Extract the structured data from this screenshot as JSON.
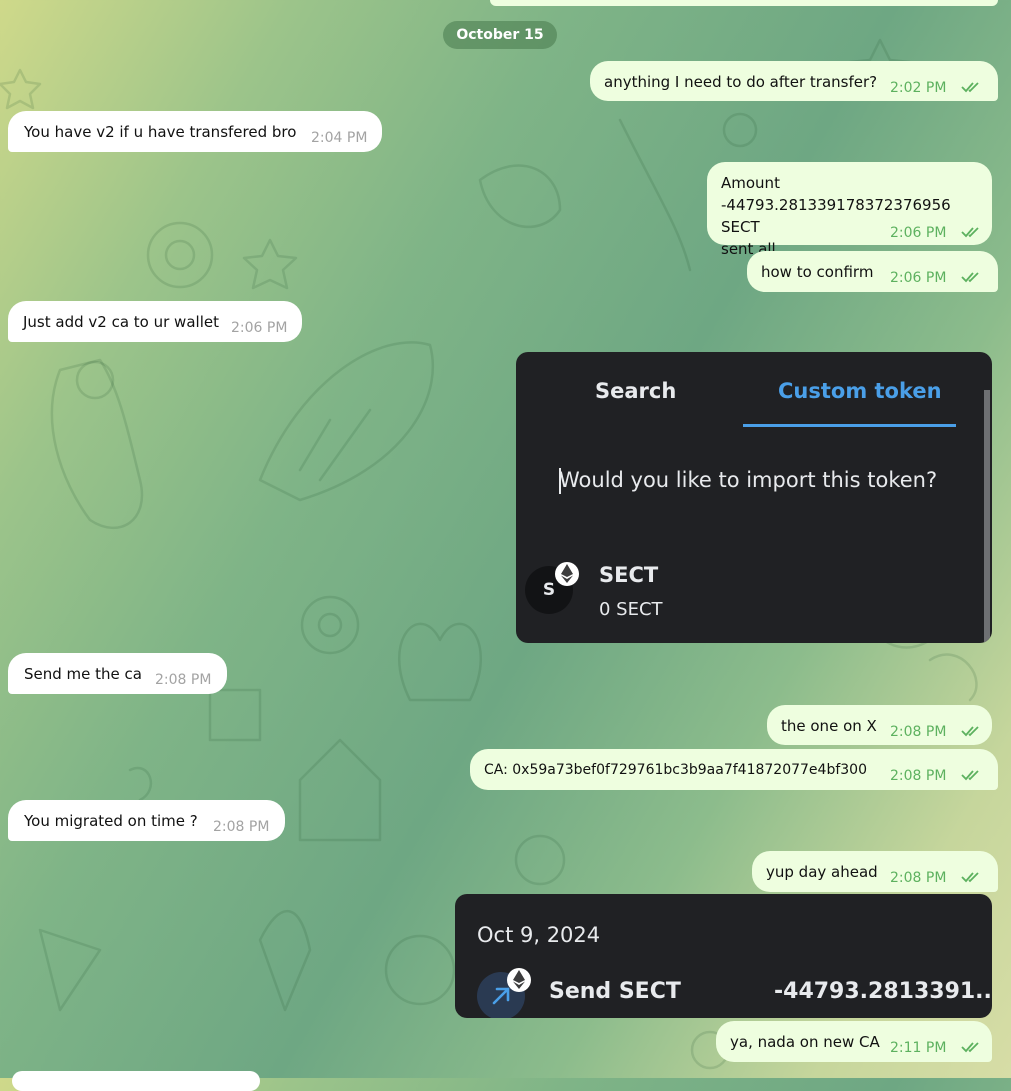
{
  "chat": {
    "date_separator": "October 15",
    "messages": [
      {
        "id": "m1",
        "text": "anything I need to do after transfer?",
        "time": "2:02 PM"
      },
      {
        "id": "m2",
        "text": "You have v2 if u have transfered bro",
        "time": "2:04 PM"
      },
      {
        "id": "m3",
        "lines": [
          "Amount",
          "-44793.281339178372376956 SECT",
          "sent all"
        ],
        "time": "2:06 PM"
      },
      {
        "id": "m4",
        "text": "how to confirm",
        "time": "2:06 PM"
      },
      {
        "id": "m5",
        "text": "Just add v2 ca to ur wallet",
        "time": "2:06 PM"
      },
      {
        "id": "m6",
        "text": "Send me the ca",
        "time": "2:08 PM"
      },
      {
        "id": "m7",
        "text": "the one on X",
        "time": "2:08 PM"
      },
      {
        "id": "m8",
        "text": "CA: 0x59a73bef0f729761bc3b9aa7f41872077e4bf300",
        "time": "2:08 PM"
      },
      {
        "id": "m9",
        "text": "You migrated on time ?",
        "time": "2:08 PM"
      },
      {
        "id": "m10",
        "text": "yup day ahead",
        "time": "2:08 PM"
      },
      {
        "id": "m11",
        "text": "ya, nada on new CA",
        "time": "2:11 PM"
      }
    ],
    "token_screenshot": {
      "tab_search": "Search",
      "tab_custom": "Custom token",
      "question": "Would you like to import this token?",
      "token_letter": "S",
      "token_name": "SECT",
      "token_balance": "0 SECT"
    },
    "tx_screenshot": {
      "date": "Oct 9, 2024",
      "action": "Send SECT",
      "amount": "-44793.2813391..."
    }
  },
  "colors": {
    "incoming_bubble": "#ffffff",
    "outgoing_bubble": "#eefedf",
    "time_outgoing": "#5db15f",
    "time_incoming": "#a3a3a3",
    "wallet_dark": "#202124",
    "wallet_accent": "#4a9fe8"
  },
  "icons": [
    "double-check-icon",
    "ethereum-icon",
    "send-arrow-icon"
  ]
}
